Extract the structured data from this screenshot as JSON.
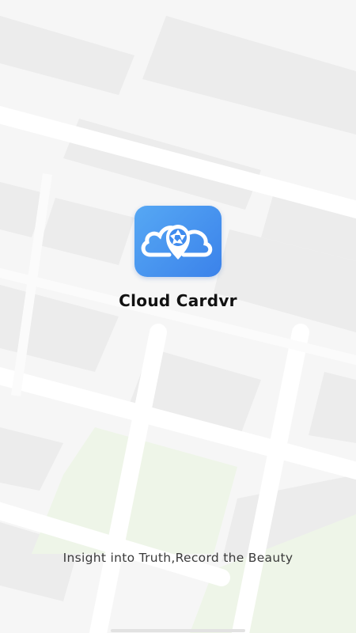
{
  "app": {
    "name": "Cloud Cardvr",
    "tagline": "Insight into Truth,Record the Beauty"
  },
  "icons": {
    "app_logo": "cloud-camera-aperture-icon"
  },
  "colors": {
    "icon_gradient_start": "#56a8f4",
    "icon_gradient_end": "#3b82ea",
    "map_background": "#f7f7f7",
    "map_block": "#ececec",
    "map_road": "#ffffff",
    "map_park": "#eef6e8",
    "title_text": "#111111",
    "tagline_text": "#3a3a3a"
  }
}
